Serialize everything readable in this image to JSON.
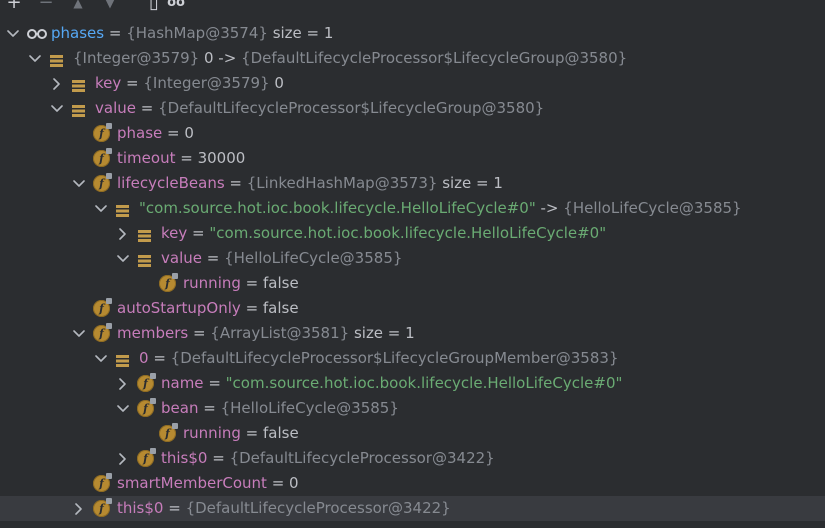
{
  "toolbar": {
    "buttons": [
      {
        "name": "add-watch-icon",
        "glyph": "+"
      },
      {
        "name": "remove-watch-icon",
        "glyph": "−"
      },
      {
        "name": "move-up-icon",
        "glyph": "▲"
      },
      {
        "name": "move-down-icon",
        "glyph": "▼"
      },
      {
        "name": "copy-icon",
        "glyph": "▯"
      },
      {
        "name": "glasses-icon",
        "glyph": "oo"
      }
    ]
  },
  "rows": [
    {
      "depth": 0,
      "arrow": "down",
      "icon": "watch",
      "name": "phases",
      "sep": " = ",
      "ref": "{HashMap@3574}",
      "extra": "  size = 1"
    },
    {
      "depth": 1,
      "arrow": "down",
      "icon": "list",
      "name": "",
      "sep": "",
      "ref": "{Integer@3579}",
      "extra": " 0 -> ",
      "ref2": "{DefaultLifecycleProcessor$LifecycleGroup@3580}"
    },
    {
      "depth": 2,
      "arrow": "right",
      "icon": "list",
      "name": "key",
      "sep": " = ",
      "ref": "{Integer@3579}",
      "extra": " 0"
    },
    {
      "depth": 2,
      "arrow": "down",
      "icon": "list",
      "name": "value",
      "sep": " = ",
      "ref": "{DefaultLifecycleProcessor$LifecycleGroup@3580}"
    },
    {
      "depth": 3,
      "arrow": "",
      "icon": "field",
      "name": "phase",
      "sep": " = ",
      "value": "0"
    },
    {
      "depth": 3,
      "arrow": "",
      "icon": "field",
      "name": "timeout",
      "sep": " = ",
      "value": "30000"
    },
    {
      "depth": 3,
      "arrow": "down",
      "icon": "field",
      "name": "lifecycleBeans",
      "sep": " = ",
      "ref": "{LinkedHashMap@3573}",
      "extra": "  size = 1"
    },
    {
      "depth": 4,
      "arrow": "down",
      "icon": "list",
      "name": "",
      "sep": "",
      "str": "\"com.source.hot.ioc.book.lifecycle.HelloLifeCycle#0\"",
      "extra": " -> ",
      "ref2": "{HelloLifeCycle@3585}"
    },
    {
      "depth": 5,
      "arrow": "right",
      "icon": "list",
      "name": "key",
      "sep": " = ",
      "str": "\"com.source.hot.ioc.book.lifecycle.HelloLifeCycle#0\""
    },
    {
      "depth": 5,
      "arrow": "down",
      "icon": "list",
      "name": "value",
      "sep": " = ",
      "ref": "{HelloLifeCycle@3585}"
    },
    {
      "depth": 6,
      "arrow": "",
      "icon": "field",
      "name": "running",
      "sep": " = ",
      "value": "false"
    },
    {
      "depth": 3,
      "arrow": "",
      "icon": "field",
      "name": "autoStartupOnly",
      "sep": " = ",
      "value": "false"
    },
    {
      "depth": 3,
      "arrow": "down",
      "icon": "field",
      "name": "members",
      "sep": " = ",
      "ref": "{ArrayList@3581}",
      "extra": "  size = 1"
    },
    {
      "depth": 4,
      "arrow": "down",
      "icon": "list",
      "name": "0",
      "sep": " = ",
      "ref": "{DefaultLifecycleProcessor$LifecycleGroupMember@3583}"
    },
    {
      "depth": 5,
      "arrow": "right",
      "icon": "field",
      "name": "name",
      "sep": " = ",
      "str": "\"com.source.hot.ioc.book.lifecycle.HelloLifeCycle#0\""
    },
    {
      "depth": 5,
      "arrow": "down",
      "icon": "field",
      "name": "bean",
      "sep": " = ",
      "ref": "{HelloLifeCycle@3585}"
    },
    {
      "depth": 6,
      "arrow": "",
      "icon": "field",
      "name": "running",
      "sep": " = ",
      "value": "false"
    },
    {
      "depth": 5,
      "arrow": "right",
      "icon": "field",
      "name": "this$0",
      "sep": " = ",
      "ref": "{DefaultLifecycleProcessor@3422}"
    },
    {
      "depth": 3,
      "arrow": "",
      "icon": "field",
      "name": "smartMemberCount",
      "sep": " = ",
      "value": "0"
    },
    {
      "depth": 3,
      "arrow": "right",
      "icon": "field",
      "name": "this$0",
      "sep": " = ",
      "ref": "{DefaultLifecycleProcessor@3422}",
      "selected": true
    }
  ]
}
